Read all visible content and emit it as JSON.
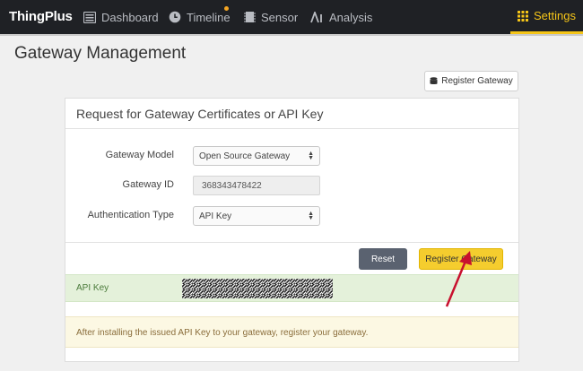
{
  "nav": {
    "brand": "ThingPlus",
    "items": [
      {
        "label": "Dashboard",
        "icon": "dashboard-icon"
      },
      {
        "label": "Timeline",
        "icon": "clock-icon"
      },
      {
        "label": "Sensor",
        "icon": "chip-icon"
      },
      {
        "label": "Analysis",
        "icon": "analysis-icon"
      }
    ],
    "settings": {
      "label": "Settings",
      "icon": "grid-icon"
    },
    "accent_color": "#f5c518"
  },
  "page": {
    "title": "Gateway Management",
    "register_button": "Register Gateway"
  },
  "panel": {
    "title": "Request for Gateway Certificates or API Key",
    "fields": {
      "model_label": "Gateway Model",
      "model_value": "Open Source Gateway",
      "id_label": "Gateway ID",
      "id_value": "368343478422",
      "auth_label": "Authentication Type",
      "auth_value": "API Key"
    },
    "reset_label": "Reset",
    "register_label": "Register Gateway",
    "api_key_label": "API Key",
    "info_text": "After installing the issued API Key to your gateway, register your gateway."
  }
}
